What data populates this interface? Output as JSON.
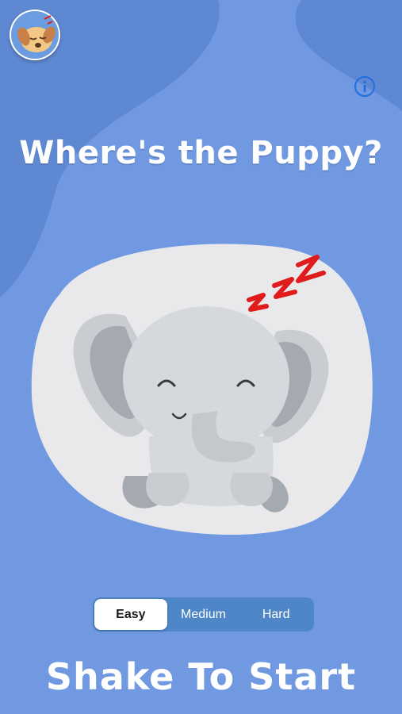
{
  "header": {
    "avatar_icon": "sleeping-puppy-icon",
    "info_icon": "info-icon"
  },
  "title": "Where's the Puppy?",
  "scene": {
    "character": "sleeping-elephant",
    "sleep_text": "ZZZ"
  },
  "difficulty": {
    "options": [
      "Easy",
      "Medium",
      "Hard"
    ],
    "selected": "Easy"
  },
  "cta": "Shake To Start",
  "colors": {
    "background": "#7099e2",
    "background_dark": "#5f88d2",
    "segment_bg": "#4e86c8",
    "info_blue": "#1e6fe0",
    "zzz_red": "#e01b1b"
  }
}
